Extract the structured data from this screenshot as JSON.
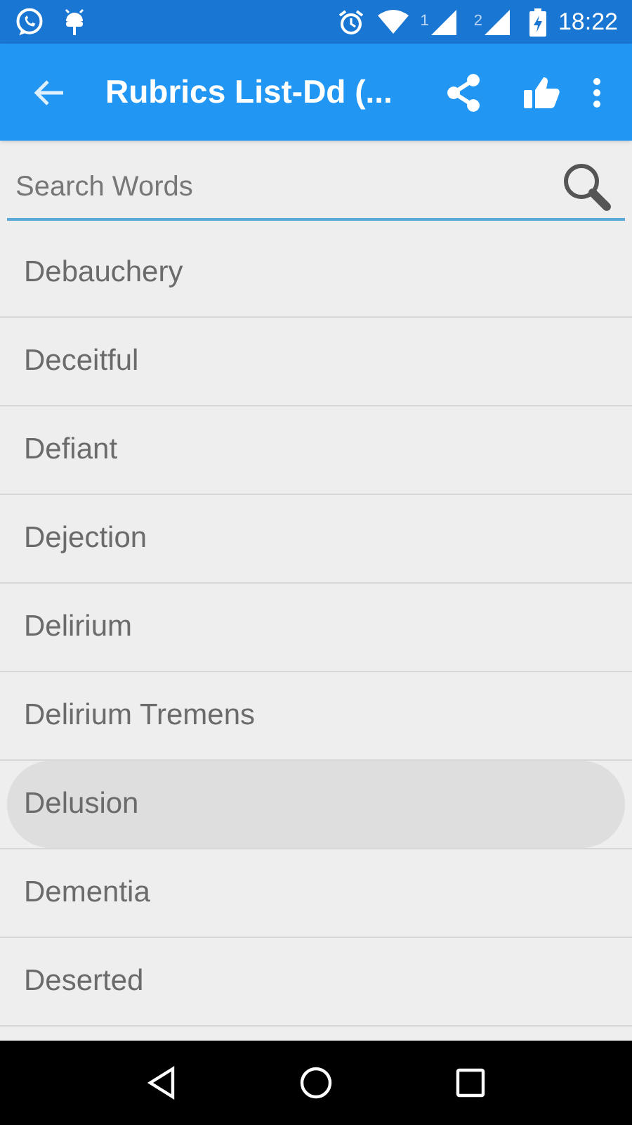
{
  "status_bar": {
    "sim_1": "1",
    "sim_2": "2",
    "time": "18:22"
  },
  "app_bar": {
    "title": "Rubrics List-Dd (..."
  },
  "search": {
    "placeholder": "Search Words"
  },
  "items": [
    {
      "label": "Debauchery",
      "selected": false
    },
    {
      "label": "Deceitful",
      "selected": false
    },
    {
      "label": "Defiant",
      "selected": false
    },
    {
      "label": "Dejection",
      "selected": false
    },
    {
      "label": "Delirium",
      "selected": false
    },
    {
      "label": "Delirium Tremens",
      "selected": false
    },
    {
      "label": "Delusion",
      "selected": true
    },
    {
      "label": "Dementia",
      "selected": false
    },
    {
      "label": "Deserted",
      "selected": false
    }
  ]
}
